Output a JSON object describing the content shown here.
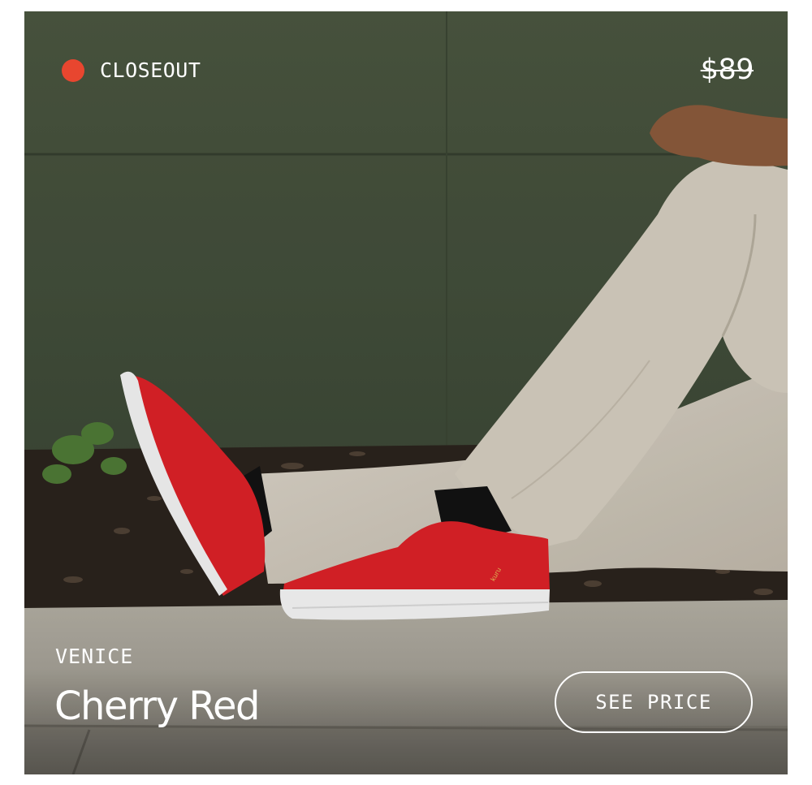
{
  "badge": {
    "label": "CLOSEOUT",
    "dot_color": "#e8462f"
  },
  "price": {
    "original": "$89",
    "strikethrough": true
  },
  "product": {
    "collection": "VENICE",
    "name": "Cherry Red",
    "shoe_tag": "kuru"
  },
  "cta": {
    "label": "SEE PRICE"
  },
  "colors": {
    "wall": "#46523b",
    "shoe": "#dc2128",
    "pants": "#d6cfc2",
    "curb": "#a6a296",
    "text": "#ffffff"
  }
}
